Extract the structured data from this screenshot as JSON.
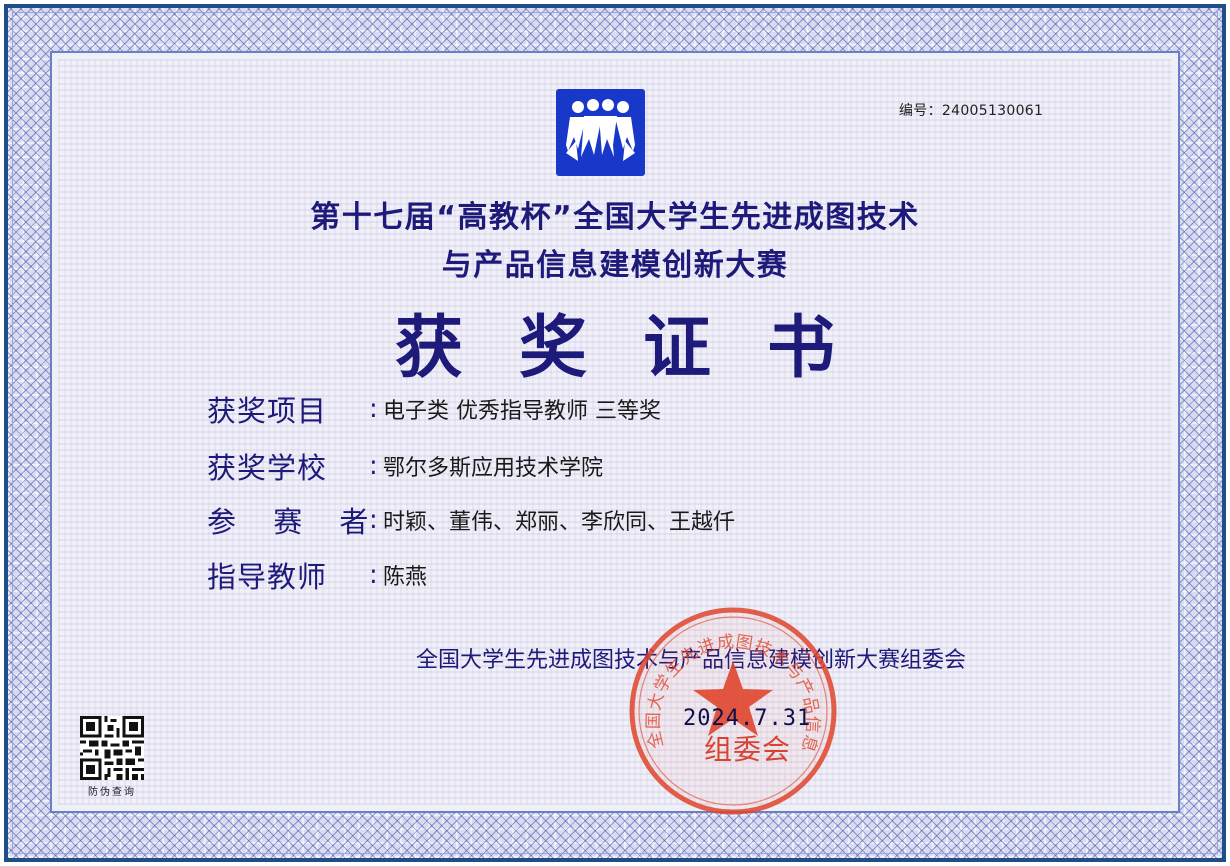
{
  "certificate": {
    "number_label": "编号：",
    "number_value": "24005130061",
    "title_line1": "第十七届“高教杯”全国大学生先进成图技术",
    "title_line2": "与产品信息建模创新大赛",
    "main_title": "获奖证书"
  },
  "fields": [
    {
      "label": "获奖项目",
      "value": "电子类 优秀指导教师 三等奖"
    },
    {
      "label": "获奖学校",
      "value": "鄂尔多斯应用技术学院"
    },
    {
      "label": "参 赛 者",
      "value": "时颖、董伟、郑丽、李欣同、王越仟"
    },
    {
      "label": "指导教师",
      "value": "陈燕"
    }
  ],
  "colon": ":",
  "issuer": {
    "committee": "全国大学生先进成图技术与产品信息建模创新大赛组委会",
    "seal_text": "全国大学生先进成图技术与产品信息建模创新大赛",
    "date": "2024.7.31",
    "seal_name": "组委会"
  },
  "qr": {
    "label": "防伪查询"
  },
  "colors": {
    "title": "#1d1a7a",
    "logo": "#1738c8",
    "seal": "#d8321e",
    "frame": "#1e4f88"
  }
}
